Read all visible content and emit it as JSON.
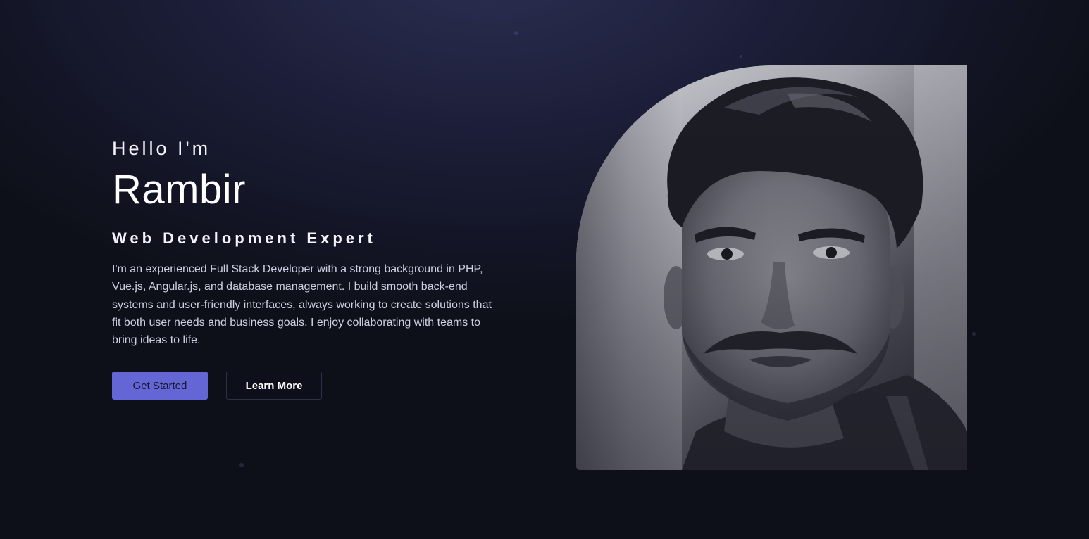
{
  "hero": {
    "greeting": "Hello I'm",
    "name": "Rambir",
    "role": "Web Development Expert",
    "bio": "I'm an experienced Full Stack Developer with a strong background in PHP, Vue.js, Angular.js, and database management. I build smooth back-end systems and user-friendly interfaces, always working to create solutions that fit both user needs and business goals. I enjoy collaborating with teams to bring ideas to life.",
    "primary_button": "Get Started",
    "secondary_button": "Learn More"
  },
  "photo": {
    "alt": "Rambir"
  },
  "colors": {
    "accent": "#6366d4",
    "background": "#1d1f3a"
  }
}
